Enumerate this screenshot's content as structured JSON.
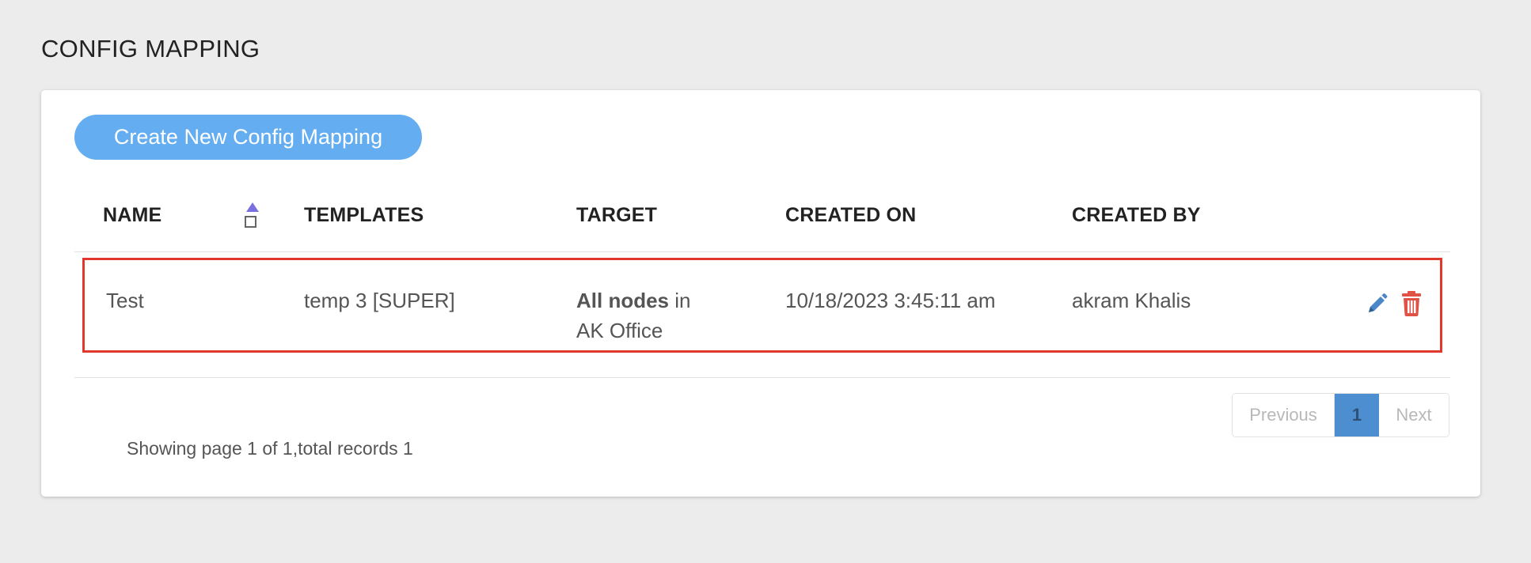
{
  "page": {
    "title": "CONFIG MAPPING"
  },
  "toolbar": {
    "create_label": "Create New Config Mapping"
  },
  "table": {
    "columns": [
      "NAME",
      "TEMPLATES",
      "TARGET",
      "CREATED ON",
      "CREATED BY"
    ],
    "sort": {
      "column": "NAME",
      "direction": "ascending"
    },
    "rows": [
      {
        "name": "Test",
        "templates": "temp 3 [SUPER]",
        "target_bold": "All nodes",
        "target_connector": " in",
        "target_location": "AK Office",
        "created_on": "10/18/2023 3:45:11 am",
        "created_by": "akram Khalis",
        "actions": [
          "pencil-icon",
          "trash-icon"
        ]
      }
    ]
  },
  "pagination": {
    "previous_label": "Previous",
    "current_page": "1",
    "next_label": "Next",
    "summary": "Showing page 1 of 1,total records 1"
  },
  "colors": {
    "background": "#ececec",
    "accent_button": "#63adf0",
    "row_highlight_border": "#e0382c",
    "edit_icon": "#4a86c8",
    "delete_icon": "#e05246",
    "active_page": "#4d8ed0"
  }
}
